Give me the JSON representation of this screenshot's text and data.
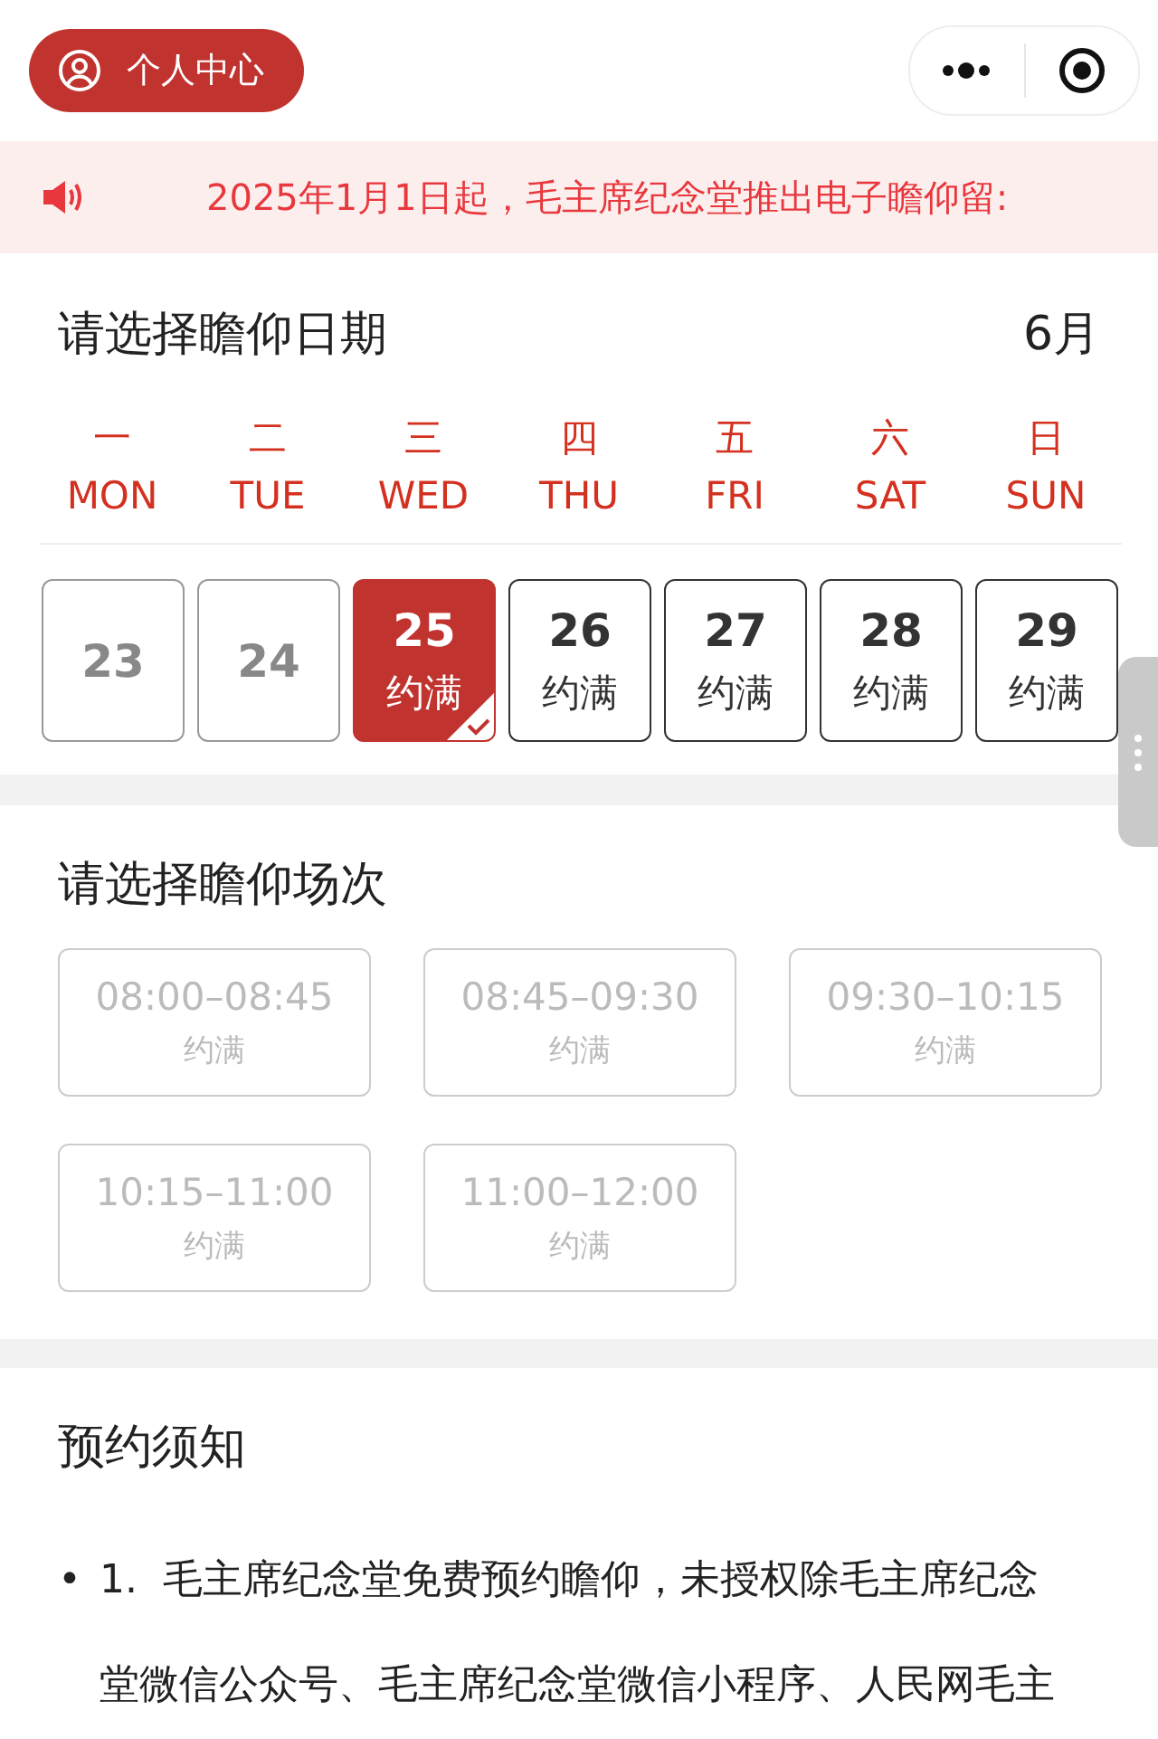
{
  "top_bar": {
    "profile_button": "个人中心"
  },
  "announcement": "2025年1月1日起，毛主席纪念堂推出电子瞻仰留:",
  "date_section": {
    "title": "请选择瞻仰日期",
    "month": "6月",
    "weekdays": [
      {
        "cn": "一",
        "en": "MON"
      },
      {
        "cn": "二",
        "en": "TUE"
      },
      {
        "cn": "三",
        "en": "WED"
      },
      {
        "cn": "四",
        "en": "THU"
      },
      {
        "cn": "五",
        "en": "FRI"
      },
      {
        "cn": "六",
        "en": "SAT"
      },
      {
        "cn": "日",
        "en": "SUN"
      }
    ],
    "dates": [
      {
        "day": "23",
        "disabled": true,
        "selected": false
      },
      {
        "day": "24",
        "disabled": true,
        "selected": false
      },
      {
        "day": "25",
        "status": "约满",
        "disabled": false,
        "selected": true
      },
      {
        "day": "26",
        "status": "约满",
        "disabled": false,
        "selected": false
      },
      {
        "day": "27",
        "status": "约满",
        "disabled": false,
        "selected": false
      },
      {
        "day": "28",
        "status": "约满",
        "disabled": false,
        "selected": false
      },
      {
        "day": "29",
        "status": "约满",
        "disabled": false,
        "selected": false
      }
    ]
  },
  "session_section": {
    "title": "请选择瞻仰场次",
    "slots": [
      {
        "time": "08:00–08:45",
        "status": "约满",
        "disabled": true
      },
      {
        "time": "08:45–09:30",
        "status": "约满",
        "disabled": true
      },
      {
        "time": "09:30–10:15",
        "status": "约满",
        "disabled": true
      },
      {
        "time": "10:15–11:00",
        "status": "约满",
        "disabled": true
      },
      {
        "time": "11:00–12:00",
        "status": "约满",
        "disabled": true
      }
    ]
  },
  "notice_section": {
    "title": "预约须知",
    "items": [
      {
        "bullet": "•",
        "text": "1.  毛主席纪念堂免费预约瞻仰，未授权除毛主席纪念堂微信公众号、毛主席纪念堂微信小程序、人民网毛主"
      }
    ]
  }
}
